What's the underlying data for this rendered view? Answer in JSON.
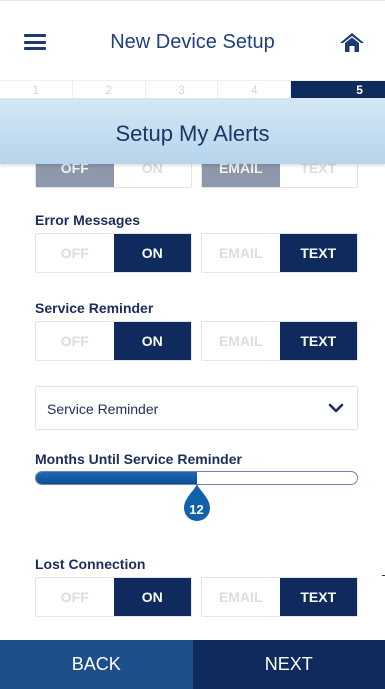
{
  "header": {
    "title": "New Device Setup",
    "menu_icon": "menu-icon",
    "home_icon": "home-icon"
  },
  "steps": [
    "1",
    "2",
    "3",
    "4",
    "5"
  ],
  "active_step": "5",
  "banner": {
    "title": "Setup My Alerts"
  },
  "alerts": [
    {
      "label": "",
      "onoff": {
        "off": "OFF",
        "on": "ON",
        "selected": "OFF"
      },
      "channel": {
        "email": "EMAIL",
        "text": "TEXT",
        "selected": "EMAIL"
      }
    },
    {
      "label": "Error Messages",
      "onoff": {
        "off": "OFF",
        "on": "ON",
        "selected": "ON"
      },
      "channel": {
        "email": "EMAIL",
        "text": "TEXT",
        "selected": "TEXT"
      }
    },
    {
      "label": "Service Reminder",
      "onoff": {
        "off": "OFF",
        "on": "ON",
        "selected": "ON"
      },
      "channel": {
        "email": "EMAIL",
        "text": "TEXT",
        "selected": "TEXT"
      }
    },
    {
      "label": "Lost Connection",
      "onoff": {
        "off": "OFF",
        "on": "ON",
        "selected": "ON"
      },
      "channel": {
        "email": "EMAIL",
        "text": "TEXT",
        "selected": "TEXT"
      }
    }
  ],
  "service_select": {
    "value": "Service Reminder"
  },
  "slider": {
    "label": "Months Until Service Reminder",
    "value": "12",
    "fraction": 0.5
  },
  "footer": {
    "back": "BACK",
    "next": "NEXT"
  },
  "colors": {
    "navy": "#0f2a5c",
    "back_blue": "#1f4f8a",
    "banner": "#c4ddf1",
    "slider_blue": "#1461ab"
  }
}
